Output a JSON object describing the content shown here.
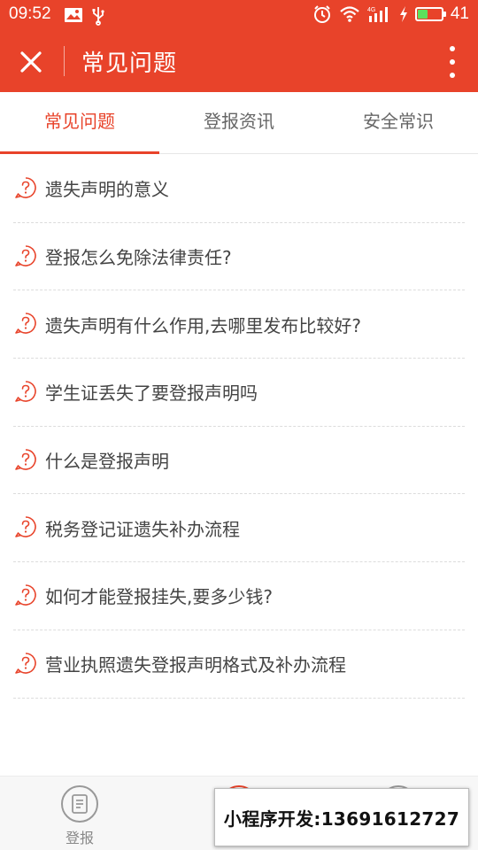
{
  "status_bar": {
    "time": "09:52",
    "battery_percent": "41",
    "battery_level": 0.41,
    "network": "4G"
  },
  "navbar": {
    "title": "常见问题"
  },
  "tabs": [
    {
      "label": "常见问题",
      "active": true
    },
    {
      "label": "登报资讯",
      "active": false
    },
    {
      "label": "安全常识",
      "active": false
    }
  ],
  "faq_items": [
    "遗失声明的意义",
    "登报怎么免除法律责任?",
    "遗失声明有什么作用,去哪里发布比较好?",
    "学生证丢失了要登报声明吗",
    "什么是登报声明",
    "税务登记证遗失补办流程",
    "如何才能登报挂失,要多少钱?",
    "营业执照遗失登报声明格式及补办流程"
  ],
  "bottom_nav": {
    "left_label": "登报"
  },
  "promo": {
    "text": "小程序开发:13691612727"
  },
  "colors": {
    "brand": "#e8432a",
    "text": "#444444",
    "tab_inactive": "#666666"
  }
}
